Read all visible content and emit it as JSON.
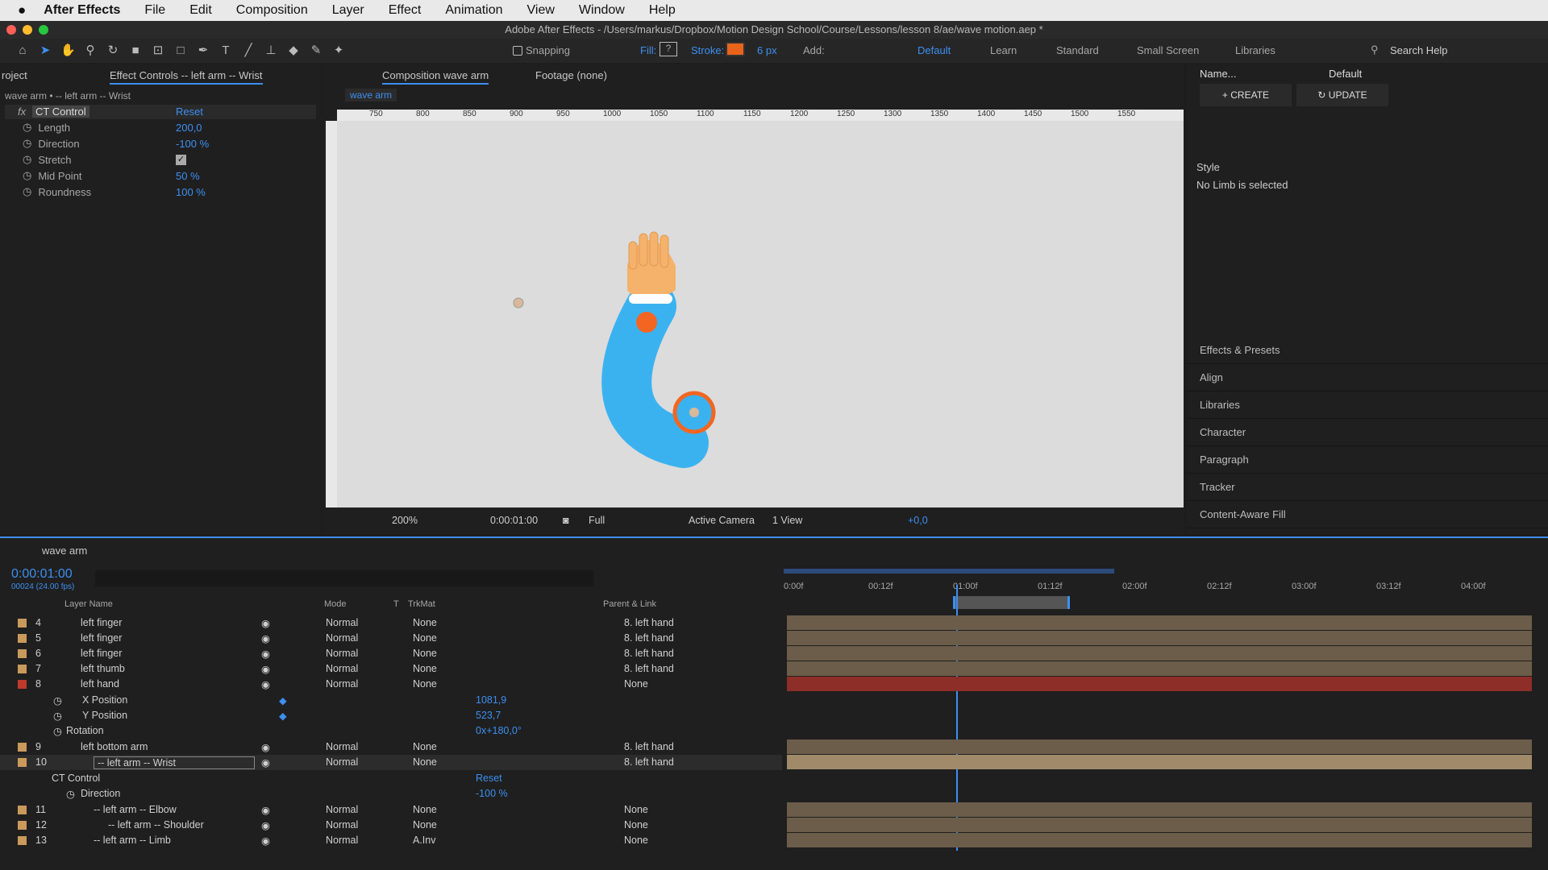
{
  "menubar": {
    "app": "After Effects",
    "items": [
      "File",
      "Edit",
      "Composition",
      "Layer",
      "Effect",
      "Animation",
      "View",
      "Window",
      "Help"
    ]
  },
  "window_title": "Adobe After Effects - /Users/markus/Dropbox/Motion Design School/Course/Lessons/lesson 8/ae/wave motion.aep *",
  "toolbar": {
    "snapping": "Snapping",
    "fill": "Fill:",
    "fill_value": "?",
    "stroke": "Stroke:",
    "stroke_px": "6 px",
    "add": "Add:",
    "workspaces": [
      "Default",
      "Learn",
      "Standard",
      "Small Screen",
      "Libraries"
    ],
    "search": "Search Help"
  },
  "effect_panel": {
    "project_tab": "roject",
    "tab": "Effect Controls -- left arm -- Wrist",
    "breadcrumb": "wave arm • -- left arm -- Wrist",
    "effect_name": "CT Control",
    "reset": "Reset",
    "props": [
      {
        "name": "Length",
        "value": "200,0"
      },
      {
        "name": "Direction",
        "value": "-100 %"
      },
      {
        "name": "Stretch",
        "value": ""
      },
      {
        "name": "Mid Point",
        "value": "50 %"
      },
      {
        "name": "Roundness",
        "value": "100 %"
      }
    ]
  },
  "comp_panel": {
    "tab": "Composition wave arm",
    "footage_tab": "Footage (none)",
    "comp_name": "wave arm",
    "ruler": [
      "750",
      "800",
      "850",
      "900",
      "950",
      "1000",
      "1050",
      "1100",
      "1150",
      "1200",
      "1250",
      "1300",
      "1350",
      "1400",
      "1450",
      "1500",
      "1550"
    ],
    "zoom": "200%",
    "time": "0:00:01:00",
    "quality": "Full",
    "camera": "Active Camera",
    "views": "1 View",
    "exposure": "+0,0"
  },
  "right_panel": {
    "name_label": "Name...",
    "preset": "Default",
    "create": "CREATE",
    "update": "UPDATE",
    "style": "Style",
    "no_limb": "No Limb is selected",
    "panels": [
      "Effects & Presets",
      "Align",
      "Libraries",
      "Character",
      "Paragraph",
      "Tracker",
      "Content-Aware Fill"
    ]
  },
  "timeline": {
    "tab": "wave arm",
    "timecode": "0:00:01:00",
    "frames": "00024 (24.00 fps)",
    "headers": {
      "layer_name": "Layer Name",
      "mode": "Mode",
      "t": "T",
      "trkmat": "TrkMat",
      "parent": "Parent & Link"
    },
    "ruler": [
      "0:00f",
      "00:12f",
      "01:00f",
      "01:12f",
      "02:00f",
      "02:12f",
      "03:00f",
      "03:12f",
      "04:00f"
    ],
    "layers": [
      {
        "num": "4",
        "name": "left finger",
        "mode": "Normal",
        "trk": "None",
        "parent": "8. left hand",
        "color": "#c99a5b"
      },
      {
        "num": "5",
        "name": "left finger",
        "mode": "Normal",
        "trk": "None",
        "parent": "8. left hand",
        "color": "#c99a5b"
      },
      {
        "num": "6",
        "name": "left finger",
        "mode": "Normal",
        "trk": "None",
        "parent": "8. left hand",
        "color": "#c99a5b"
      },
      {
        "num": "7",
        "name": "left thumb",
        "mode": "Normal",
        "trk": "None",
        "parent": "8. left hand",
        "color": "#c99a5b"
      },
      {
        "num": "8",
        "name": "left hand",
        "mode": "Normal",
        "trk": "None",
        "parent": "None",
        "color": "#c0392b"
      }
    ],
    "props8": [
      {
        "name": "X Position",
        "value": "1081,9"
      },
      {
        "name": "Y Position",
        "value": "523,7"
      },
      {
        "name": "Rotation",
        "value": "0x+180,0°"
      }
    ],
    "layers2": [
      {
        "num": "9",
        "name": "left bottom arm",
        "mode": "Normal",
        "trk": "None",
        "parent": "8. left hand",
        "color": "#c99a5b"
      },
      {
        "num": "10",
        "name": "-- left arm -- Wrist",
        "mode": "Normal",
        "trk": "None",
        "parent": "8. left hand",
        "color": "#c99a5b"
      }
    ],
    "ct_control": "CT Control",
    "ct_reset": "Reset",
    "ct_direction": "Direction",
    "ct_direction_value": "-100 %",
    "layers3": [
      {
        "num": "11",
        "name": "-- left arm -- Elbow",
        "mode": "Normal",
        "trk": "None",
        "parent": "None",
        "color": "#c99a5b"
      },
      {
        "num": "12",
        "name": "-- left arm -- Shoulder",
        "mode": "Normal",
        "trk": "None",
        "parent": "None",
        "color": "#c99a5b"
      },
      {
        "num": "13",
        "name": "-- left arm -- Limb",
        "mode": "Normal",
        "trk": "A.Inv",
        "parent": "None",
        "color": "#c99a5b"
      }
    ]
  },
  "colors": {
    "accent": "#3d8ff0",
    "arm": "#3bb2f0",
    "hand": "#f5b26b",
    "joint": "#f26622"
  }
}
